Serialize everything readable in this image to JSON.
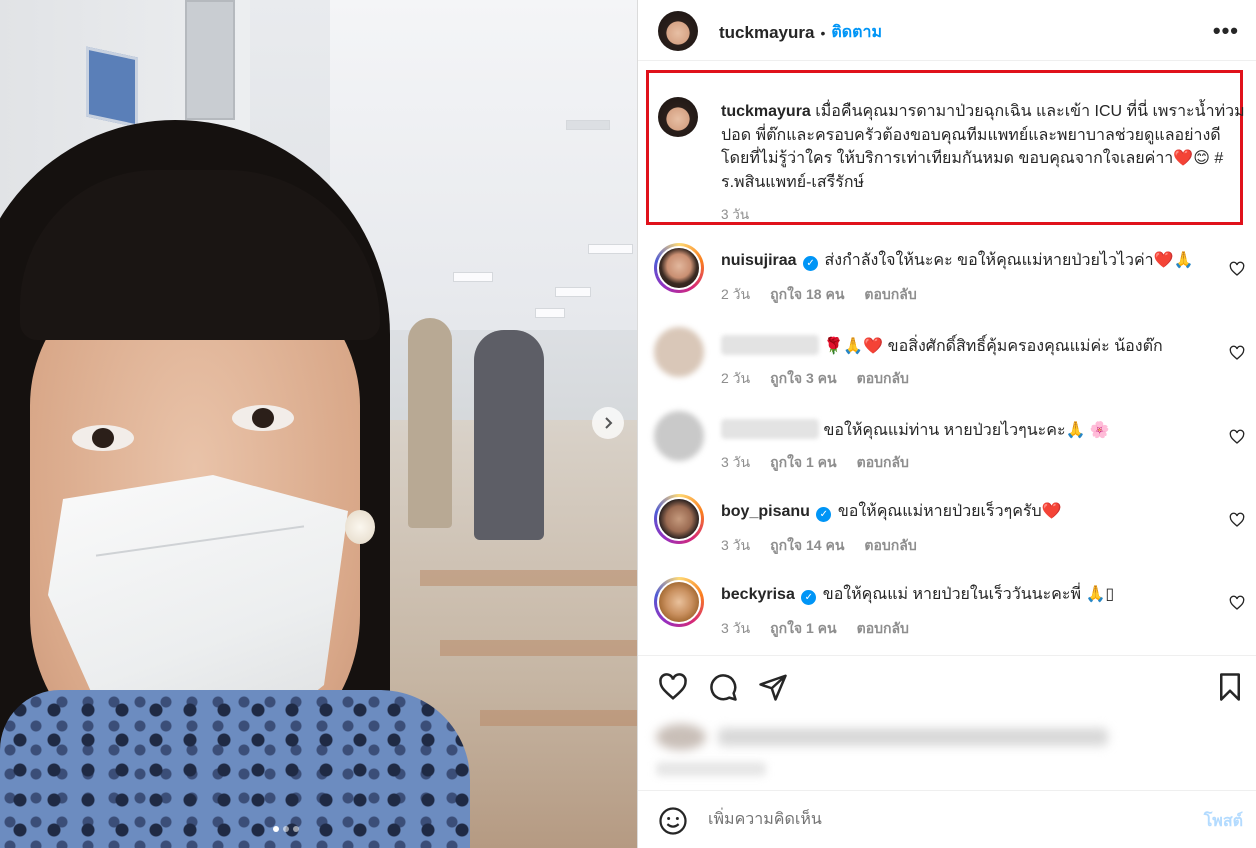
{
  "header": {
    "username": "tuckmayura",
    "separator": "•",
    "follow_label": "ติดตาม",
    "more_label": "•••"
  },
  "photo": {
    "icon_next": "chevron-right-icon",
    "carousel_index": 1,
    "carousel_total": 3
  },
  "caption": {
    "username": "tuckmayura",
    "text": "เมื่อคืนคุณมารดามาป่วยฉุกเฉิน และเข้า ICU ที่นี่ เพราะน้ำท่วมปอด พี่ต๊กและครอบครัวต้องขอบคุณทีมแพทย์และพยาบาลช่วยดูแลอย่างดี โดยที่ไม่รู้ว่าใคร ให้บริการเท่าเทียมกันหมด ขอบคุณจากใจเลยค่าา❤️😊 # ร.พสินแพทย์-เสรีรักษ์",
    "time": "3 วัน"
  },
  "comments": [
    {
      "username": "nuisujiraa",
      "verified": true,
      "text": "ส่งกำลังใจให้นะคะ ขอให้คุณแม่หายป่วยไวไวค่า❤️🙏",
      "time": "2 วัน",
      "likes": "ถูกใจ 18 คน",
      "reply": "ตอบกลับ"
    },
    {
      "username": "",
      "verified": false,
      "text": "🌹🙏❤️ ขอสิ่งศักดิ์สิทธิ์คุ้มครองคุณแม่ค่ะ น้องต๊ก",
      "time": "2 วัน",
      "likes": "ถูกใจ 3 คน",
      "reply": "ตอบกลับ"
    },
    {
      "username": "",
      "verified": false,
      "text": "ขอให้คุณแม่ท่าน หายป่วยไวๆนะคะ🙏 🌸",
      "time": "3 วัน",
      "likes": "ถูกใจ 1 คน",
      "reply": "ตอบกลับ"
    },
    {
      "username": "boy_pisanu",
      "verified": true,
      "text": "ขอให้คุณแม่หายป่วยเร็วๆครับ❤️",
      "time": "3 วัน",
      "likes": "ถูกใจ 14 คน",
      "reply": "ตอบกลับ"
    },
    {
      "username": "beckyrisa",
      "verified": true,
      "text": "ขอให้คุณแม่ หายป่วยในเร็ววันนะคะพี่ 🙏▯",
      "time": "3 วัน",
      "likes": "ถูกใจ 1 คน",
      "reply": "ตอบกลับ"
    }
  ],
  "actions": {
    "like_icon": "heart-icon",
    "comment_icon": "comment-icon",
    "share_icon": "send-icon",
    "save_icon": "bookmark-icon"
  },
  "add_comment": {
    "emoji_icon": "emoji-icon",
    "placeholder": "เพิ่มความคิดเห็น",
    "post_label": "โพสต์"
  }
}
